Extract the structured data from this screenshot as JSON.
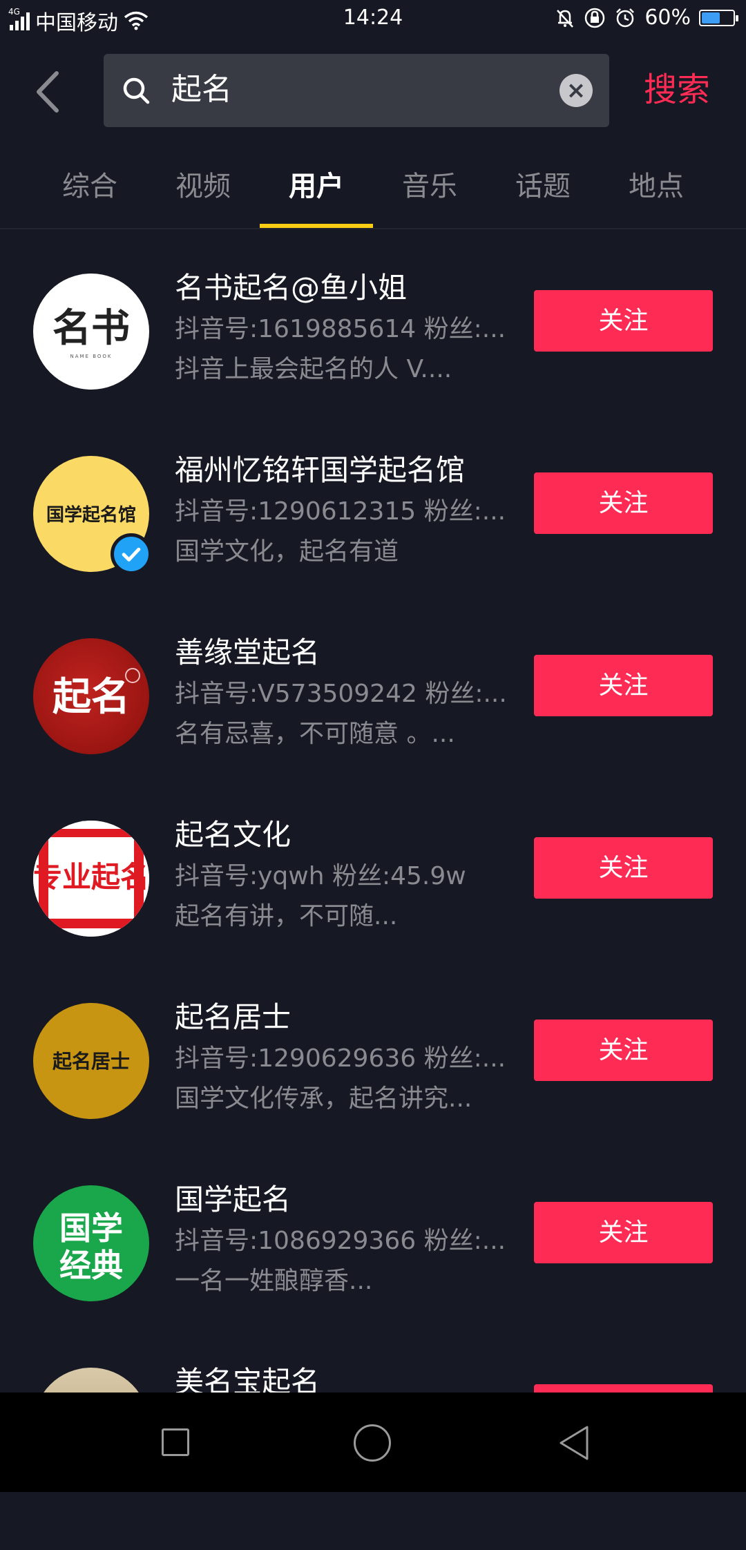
{
  "status_bar": {
    "network": "4G",
    "carrier": "中国移动",
    "time": "14:24",
    "battery": "60%",
    "battery_level": 0.6
  },
  "search": {
    "query": "起名",
    "submit_label": "搜索"
  },
  "tabs": [
    {
      "label": "综合",
      "active": false
    },
    {
      "label": "视频",
      "active": false
    },
    {
      "label": "用户",
      "active": true
    },
    {
      "label": "音乐",
      "active": false
    },
    {
      "label": "话题",
      "active": false
    },
    {
      "label": "地点",
      "active": false
    }
  ],
  "users": [
    {
      "name": "名书起名@鱼小姐",
      "info": "抖音号:1619885614 粉丝:...",
      "desc": "抖音上最会起名的人  V....",
      "follow": "关注",
      "avatar_text": "名书",
      "avatar_subtext": "NAME BOOK",
      "verified": false
    },
    {
      "name": "福州忆铭轩国学起名馆",
      "info": "抖音号:1290612315 粉丝:...",
      "desc": "国学文化，起名有道",
      "follow": "关注",
      "avatar_text": "国学起名馆",
      "verified": true
    },
    {
      "name": "善缘堂起名",
      "info": "抖音号:V573509242 粉丝:...",
      "desc": "名有忌喜，不可随意 。...",
      "follow": "关注",
      "avatar_text": "起名",
      "verified": false
    },
    {
      "name": "起名文化",
      "info": "抖音号:yqwh 粉丝:45.9w",
      "desc": "起名有讲，不可随...",
      "follow": "关注",
      "avatar_text": "专业起名",
      "verified": false
    },
    {
      "name": "起名居士",
      "info": "抖音号:1290629636 粉丝:...",
      "desc": "国学文化传承，起名讲究...",
      "follow": "关注",
      "avatar_text": "起名居士",
      "verified": false
    },
    {
      "name": "国学起名",
      "info": "抖音号:1086929366 粉丝:...",
      "desc": "一名一姓酿醇香...",
      "follow": "关注",
      "avatar_text": "国学经典",
      "verified": false
    },
    {
      "name": "美名宝起名",
      "info": "",
      "desc": "",
      "follow": "关注",
      "verified": false
    }
  ],
  "colors": {
    "background": "#161823",
    "accent": "#fe2c55",
    "tab_indicator": "#face15",
    "muted_text": "#8a8b91"
  }
}
